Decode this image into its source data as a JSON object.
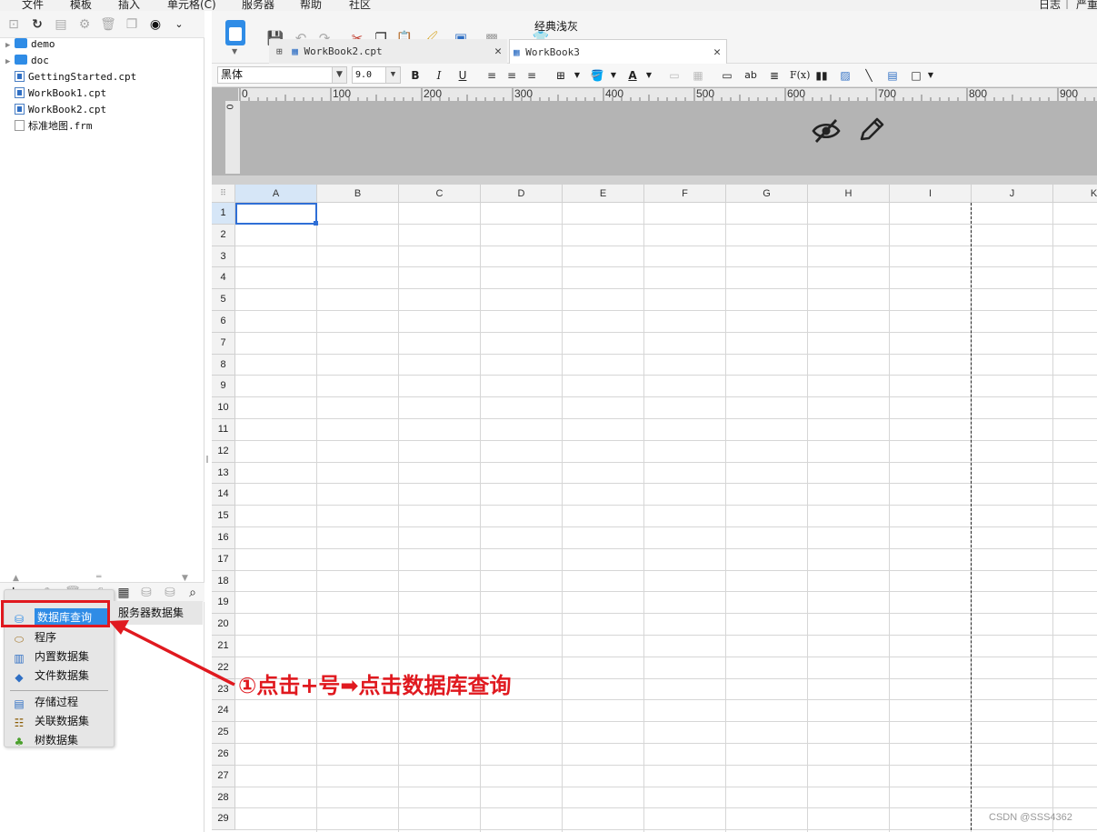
{
  "menubar": {
    "items": [
      "文件",
      "模板",
      "插入",
      "单元格(C)",
      "服务器",
      "帮助",
      "社区"
    ],
    "right_items": [
      "日志",
      "|",
      "严重"
    ]
  },
  "file_tree": [
    {
      "label": "demo",
      "type": "folder"
    },
    {
      "label": "doc",
      "type": "folder"
    },
    {
      "label": "GettingStarted.cpt",
      "type": "cpt"
    },
    {
      "label": "WorkBook1.cpt",
      "type": "cpt"
    },
    {
      "label": "WorkBook2.cpt",
      "type": "cpt"
    },
    {
      "label": "标准地图.frm",
      "type": "frm"
    }
  ],
  "dataset_menu": {
    "add_label": "+",
    "items": [
      "数据库查询",
      "程序",
      "内置数据集",
      "文件数据集",
      "存储过程",
      "关联数据集",
      "树数据集"
    ],
    "server_dataset": "服务器数据集"
  },
  "toolbar": {
    "theme_label": "经典浅灰"
  },
  "tabs": [
    {
      "label": "WorkBook2.cpt",
      "active": false
    },
    {
      "label": "WorkBook3",
      "active": true
    }
  ],
  "format": {
    "font": "黑体",
    "size": "9.0"
  },
  "ruler": {
    "labels": [
      "0",
      "100",
      "200",
      "300",
      "400",
      "500",
      "600",
      "700",
      "800",
      "900"
    ],
    "vertical_label": "0"
  },
  "sheet": {
    "columns": [
      "A",
      "B",
      "C",
      "D",
      "E",
      "F",
      "G",
      "H",
      "I",
      "J",
      "K"
    ],
    "rows": [
      "1",
      "2",
      "3",
      "4",
      "5",
      "6",
      "7",
      "8",
      "9",
      "10",
      "11",
      "12",
      "13",
      "14",
      "15",
      "16",
      "17",
      "18",
      "19",
      "20",
      "21",
      "22",
      "23",
      "24",
      "25",
      "26",
      "27",
      "28",
      "29"
    ],
    "selected_cell": "A1"
  },
  "annotation": {
    "text": "①点击+号➡点击数据库查询",
    "color": "#e0191f"
  },
  "watermark": "CSDN @SSS4362",
  "colors": {
    "accent": "#2f8ce6",
    "highlight": "#e0191f",
    "ruler_bg": "#b4b4b4"
  }
}
